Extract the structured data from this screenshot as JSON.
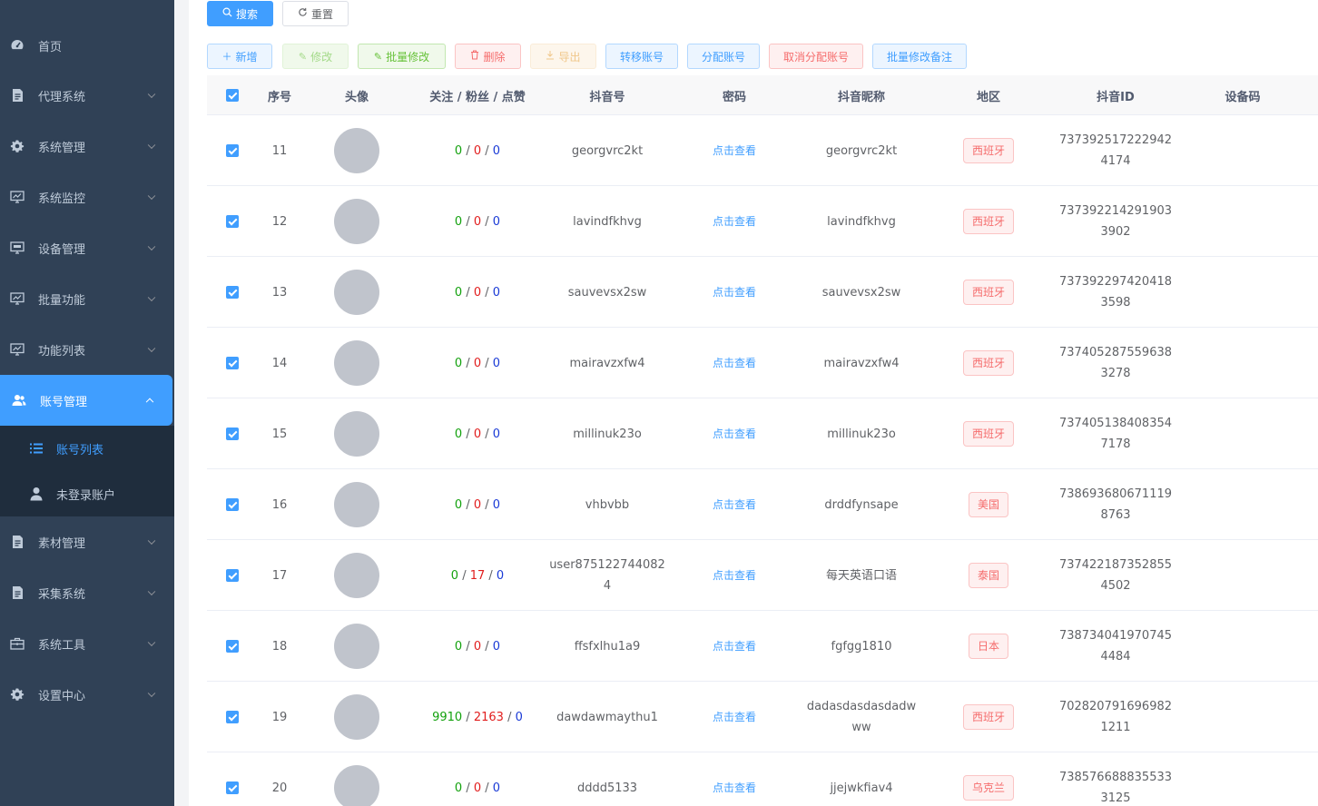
{
  "sidebar": {
    "home": "首页",
    "menus": [
      {
        "label": "代理系统",
        "icon": "document-icon"
      },
      {
        "label": "系统管理",
        "icon": "gear-icon"
      },
      {
        "label": "系统监控",
        "icon": "monitor-chart-icon"
      },
      {
        "label": "设备管理",
        "icon": "monitor-icon"
      },
      {
        "label": "批量功能",
        "icon": "monitor-chart-icon"
      },
      {
        "label": "功能列表",
        "icon": "monitor-chart-icon"
      }
    ],
    "active_menu": "账号管理",
    "submenu": [
      {
        "label": "账号列表",
        "icon": "list-icon"
      },
      {
        "label": "未登录账户",
        "icon": "user-icon"
      }
    ],
    "menus_after": [
      {
        "label": "素材管理",
        "icon": "document-icon"
      },
      {
        "label": "采集系统",
        "icon": "document-icon"
      },
      {
        "label": "系统工具",
        "icon": "toolbox-icon"
      },
      {
        "label": "设置中心",
        "icon": "gear-icon"
      }
    ]
  },
  "search": {
    "search_label": "搜索",
    "reset_label": "重置"
  },
  "toolbar": {
    "add": "新增",
    "edit": "修改",
    "batch_edit": "批量修改",
    "delete": "删除",
    "export": "导出",
    "transfer": "转移账号",
    "assign": "分配账号",
    "unassign": "取消分配账号",
    "batch_remark": "批量修改备注"
  },
  "table": {
    "headers": {
      "index": "序号",
      "avatar": "头像",
      "stats": "关注 / 粉丝 / 点赞",
      "douyin_no": "抖音号",
      "password": "密码",
      "nickname": "抖音昵称",
      "region": "地区",
      "douyin_id": "抖音ID",
      "device": "设备码"
    },
    "rows": [
      {
        "index": "11",
        "follow": "0",
        "fans": "0",
        "likes": "0",
        "douyin_no": "georgvrc2kt",
        "password": "点击查看",
        "nickname": "georgvrc2kt",
        "region": "西班牙",
        "douyin_id": "7373925172229424174",
        "device": ""
      },
      {
        "index": "12",
        "follow": "0",
        "fans": "0",
        "likes": "0",
        "douyin_no": "lavindfkhvg",
        "password": "点击查看",
        "nickname": "lavindfkhvg",
        "region": "西班牙",
        "douyin_id": "7373922142919033902",
        "device": ""
      },
      {
        "index": "13",
        "follow": "0",
        "fans": "0",
        "likes": "0",
        "douyin_no": "sauvevsx2sw",
        "password": "点击查看",
        "nickname": "sauvevsx2sw",
        "region": "西班牙",
        "douyin_id": "7373922974204183598",
        "device": ""
      },
      {
        "index": "14",
        "follow": "0",
        "fans": "0",
        "likes": "0",
        "douyin_no": "mairavzxfw4",
        "password": "点击查看",
        "nickname": "mairavzxfw4",
        "region": "西班牙",
        "douyin_id": "7374052875596383278",
        "device": ""
      },
      {
        "index": "15",
        "follow": "0",
        "fans": "0",
        "likes": "0",
        "douyin_no": "millinuk23o",
        "password": "点击查看",
        "nickname": "millinuk23o",
        "region": "西班牙",
        "douyin_id": "7374051384083547178",
        "device": ""
      },
      {
        "index": "16",
        "follow": "0",
        "fans": "0",
        "likes": "0",
        "douyin_no": "vhbvbb",
        "password": "点击查看",
        "nickname": "drddfynsape",
        "region": "美国",
        "douyin_id": "7386936806711198763",
        "device": ""
      },
      {
        "index": "17",
        "follow": "0",
        "fans": "17",
        "likes": "0",
        "douyin_no": "user8751227440824",
        "password": "点击查看",
        "nickname": "每天英语口语",
        "region": "泰国",
        "douyin_id": "7374221873528554502",
        "device": ""
      },
      {
        "index": "18",
        "follow": "0",
        "fans": "0",
        "likes": "0",
        "douyin_no": "ffsfxlhu1a9",
        "password": "点击查看",
        "nickname": "fgfgg1810",
        "region": "日本",
        "douyin_id": "7387340419707454484",
        "device": ""
      },
      {
        "index": "19",
        "follow": "9910",
        "fans": "2163",
        "likes": "0",
        "douyin_no": "dawdawmaythu1",
        "password": "点击查看",
        "nickname": "dadasdasdasdadwww",
        "region": "西班牙",
        "douyin_id": "7028207916969821211",
        "device": ""
      },
      {
        "index": "20",
        "follow": "0",
        "fans": "0",
        "likes": "0",
        "douyin_no": "dddd5133",
        "password": "点击查看",
        "nickname": "jjejwkfiav4",
        "region": "乌克兰",
        "douyin_id": "7385766888355333125",
        "device": ""
      }
    ]
  }
}
